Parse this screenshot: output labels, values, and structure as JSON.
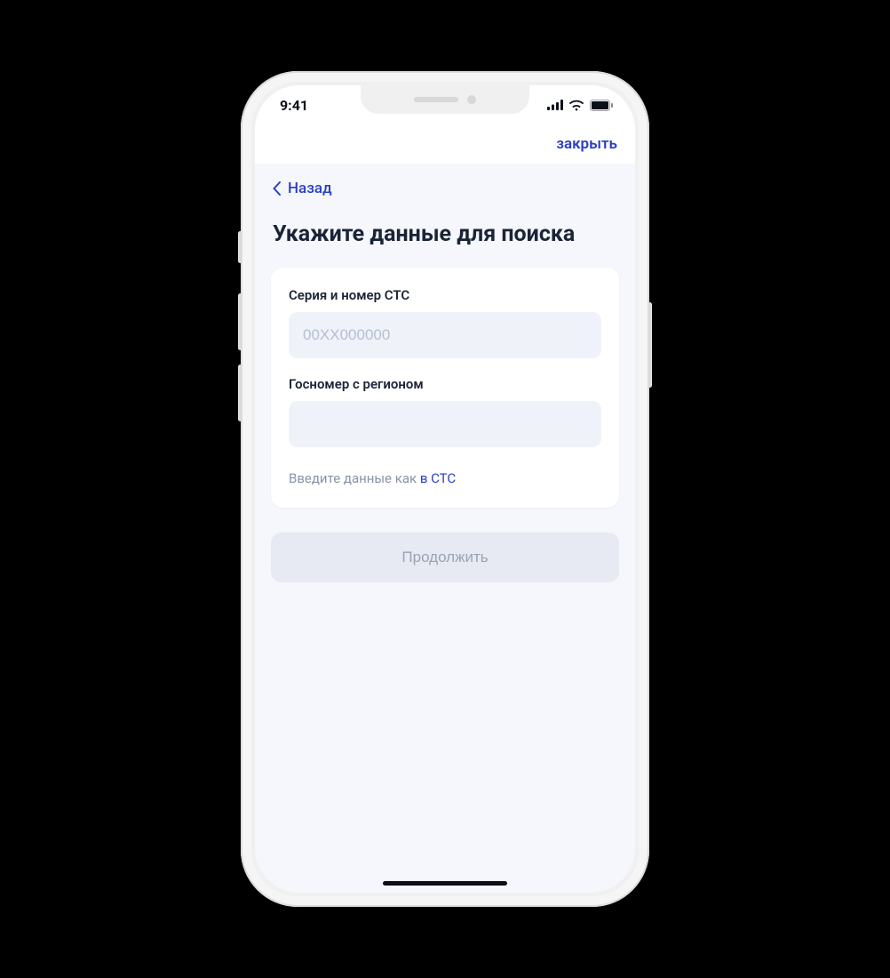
{
  "status_bar": {
    "time": "9:41"
  },
  "top_nav": {
    "close_label": "закрыть"
  },
  "back": {
    "label": "Назад"
  },
  "page": {
    "title": "Укажите данные для поиска"
  },
  "form": {
    "sts": {
      "label": "Серия и номер СТС",
      "placeholder": "00ХХ000000",
      "value": ""
    },
    "plate": {
      "label": "Госномер с регионом",
      "placeholder": "",
      "value": ""
    },
    "hint_prefix": "Введите данные как ",
    "hint_link": "в СТС"
  },
  "actions": {
    "continue_label": "Продолжить"
  },
  "colors": {
    "accent": "#2a3fc2",
    "text_primary": "#1b2436",
    "text_muted": "#8a93a6",
    "input_bg": "#eff2f8",
    "page_bg": "#f5f7fc",
    "btn_disabled_bg": "#e7eaf2",
    "btn_disabled_fg": "#9aa3b5"
  }
}
